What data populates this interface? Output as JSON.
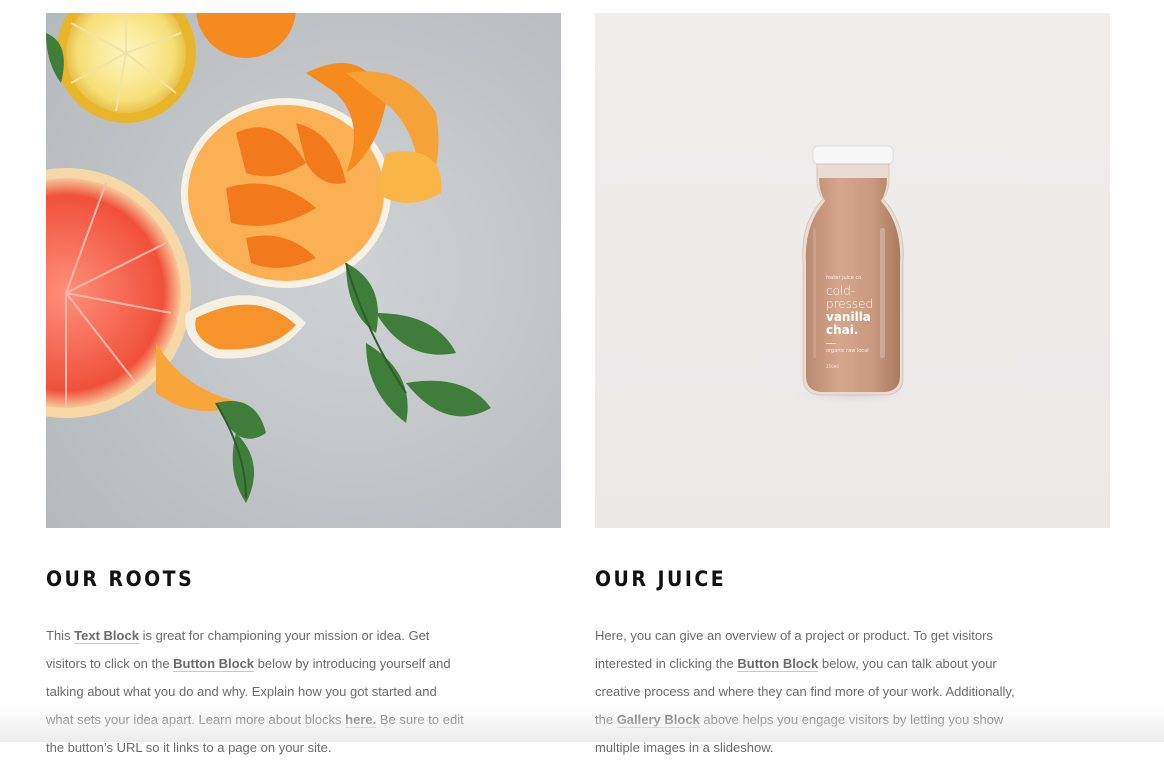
{
  "roots": {
    "heading": "OUR ROOTS",
    "t1": "This ",
    "link_text_block": "Text Block",
    "t2": " is great for championing your mission or idea. Get visitors to click on the ",
    "link_button_block": "Button Block",
    "t3": " below by introducing yourself and talking about what you do and why. Explain how you got started and what sets your idea apart. Learn more about blocks ",
    "link_here": "here.",
    "t4": " Be sure to edit the button’s URL so it links to a page on your site."
  },
  "juice": {
    "heading": "OUR JUICE",
    "t1": "Here, you can give an overview of a project or product. To get visitors interested in clicking the ",
    "link_button_block": "Button Block",
    "t2": " below, you can talk about your creative process and where they can find more of your work. Additionally, the ",
    "link_gallery_block": "Gallery Block",
    "t3": " above helps you engage visitors by letting you show multiple images in a slideshow."
  },
  "bottle_label": {
    "brand": "foster juice co.",
    "line1": "cold-",
    "line2": "pressed",
    "line3": "vanilla",
    "line4": "chai.",
    "tagline": "organic raw local",
    "volume": "250ml"
  },
  "colors": {
    "heading": "#111111",
    "body_text": "#6b6b6b",
    "bottle": "#c99a80"
  }
}
